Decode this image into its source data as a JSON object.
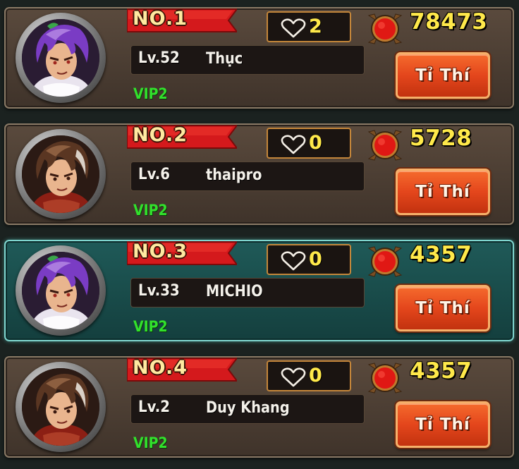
{
  "colors": {
    "card_bg": "#4e4035",
    "card_selected_bg": "#1a4b4a",
    "rank_ribbon": "#d4191c",
    "gold_text": "#ffe94a",
    "vip_green": "#32e02c",
    "button_orange": "#e4461c"
  },
  "icons": {
    "likes": "heart-outline-icon",
    "power": "red-medallion-icon"
  },
  "players": [
    {
      "rank": "NO.1",
      "likes": "2",
      "power": "78473",
      "level": "Lv.52",
      "name": "Thục",
      "vip": "VIP2",
      "button": "Tỉ Thí",
      "selected": false,
      "avatar": "purple-hair-warrior"
    },
    {
      "rank": "NO.2",
      "likes": "0",
      "power": "5728",
      "level": "Lv.6",
      "name": "thaipro",
      "vip": "VIP2",
      "button": "Tỉ Thí",
      "selected": false,
      "avatar": "brown-hair-warrior"
    },
    {
      "rank": "NO.3",
      "likes": "0",
      "power": "4357",
      "level": "Lv.33",
      "name": "MICHIO",
      "vip": "VIP2",
      "button": "Tỉ Thí",
      "selected": true,
      "avatar": "purple-hair-warrior"
    },
    {
      "rank": "NO.4",
      "likes": "0",
      "power": "4357",
      "level": "Lv.2",
      "name": "Duy Khang",
      "vip": "VIP2",
      "button": "Tỉ Thí",
      "selected": false,
      "avatar": "brown-hair-warrior"
    }
  ]
}
